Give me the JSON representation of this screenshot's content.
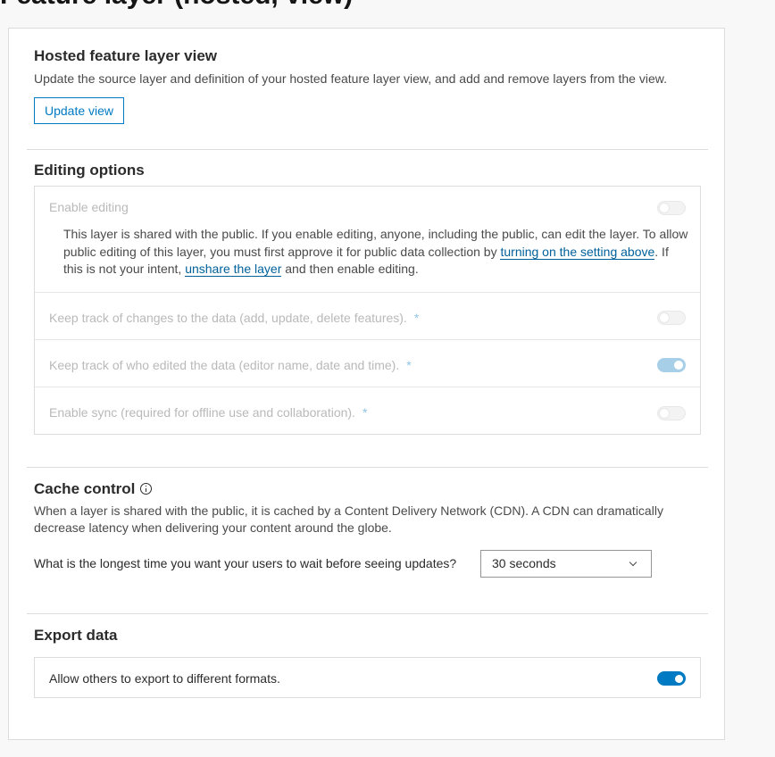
{
  "page": {
    "title": "Feature layer (hosted, view)"
  },
  "hosted_view": {
    "title": "Hosted feature layer view",
    "description": "Update the source layer and definition of your hosted feature layer view, and add and remove layers from the view.",
    "update_button": "Update view"
  },
  "editing": {
    "title": "Editing options",
    "enable_editing": {
      "label": "Enable editing",
      "enabled": false,
      "disabled": true
    },
    "notice": {
      "text_1": "This layer is shared with the public. If you enable editing, anyone, including the public, can edit the layer. To allow public editing of this layer, you must first approve it for public data collection by ",
      "link_1": "turning on the setting above",
      "text_2": ". If this is not your intent, ",
      "link_2": "unshare the layer",
      "text_3": " and then enable editing."
    },
    "options": [
      {
        "label": "Keep track of changes to the data (add, update, delete features).",
        "asterisk": "*",
        "enabled": false
      },
      {
        "label": "Keep track of who edited the data (editor name, date and time).",
        "asterisk": "*",
        "enabled": true
      },
      {
        "label": "Enable sync (required for offline use and collaboration).",
        "asterisk": "*",
        "enabled": false
      }
    ]
  },
  "cache": {
    "title": "Cache control",
    "icon": "info-icon",
    "description": "When a layer is shared with the public, it is cached by a Content Delivery Network (CDN). A CDN can dramatically decrease latency when delivering your content around the globe.",
    "question": "What is the longest time you want your users to wait before seeing updates?",
    "selected": "30 seconds"
  },
  "export": {
    "title": "Export data",
    "allow_label": "Allow others to export to different formats.",
    "enabled": true
  },
  "colors": {
    "accent": "#007ac2",
    "link": "#00619b",
    "disabled_text": "#b9b9b9"
  }
}
